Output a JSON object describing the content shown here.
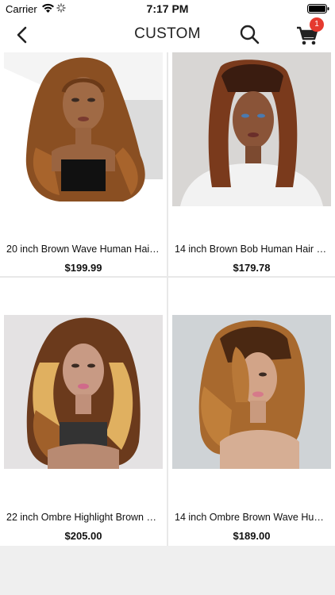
{
  "status_bar": {
    "carrier": "Carrier",
    "time": "7:17 PM"
  },
  "nav": {
    "title": "CUSTOM",
    "cart_count": "1"
  },
  "products": [
    {
      "name": "20 inch Brown Wave Human Hair…",
      "price": "$199.99",
      "image_icon": "wig-brown-wave-photo"
    },
    {
      "name": "14 inch Brown Bob Human Hair 1…",
      "price": "$179.78",
      "image_icon": "wig-brown-bob-photo"
    },
    {
      "name": "22 inch Ombre Highlight Brown W…",
      "price": "$205.00",
      "image_icon": "wig-ombre-highlight-photo"
    },
    {
      "name": "14 inch Ombre Brown Wave Hum…",
      "price": "$189.00",
      "image_icon": "wig-ombre-wave-photo"
    }
  ],
  "colors": {
    "badge": "#e53a2f",
    "background": "#efefef"
  }
}
